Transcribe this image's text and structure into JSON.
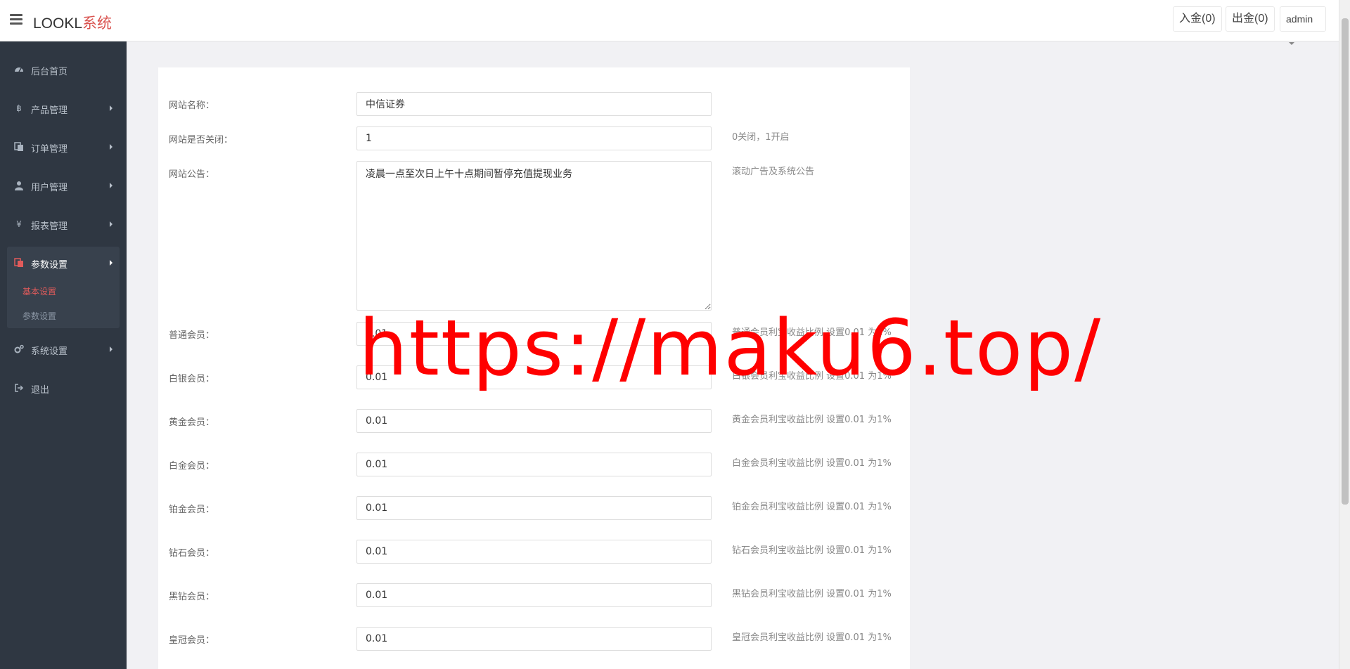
{
  "header": {
    "logo_main": "LOOKL",
    "logo_accent": "系统",
    "deposit_label": "入金(0)",
    "withdraw_label": "出金(0)",
    "user_label": "admin"
  },
  "sidebar": {
    "items": [
      {
        "label": "后台首页",
        "icon": "dashboard-icon"
      },
      {
        "label": "产品管理",
        "icon": "bitcoin-icon"
      },
      {
        "label": "订单管理",
        "icon": "copy-icon"
      },
      {
        "label": "用户管理",
        "icon": "user-icon"
      },
      {
        "label": "报表管理",
        "icon": "yen-icon"
      },
      {
        "label": "参数设置",
        "icon": "copy-icon"
      },
      {
        "label": "系统设置",
        "icon": "gears-icon"
      },
      {
        "label": "退出",
        "icon": "sign-out-icon"
      }
    ],
    "sub_items": [
      {
        "label": "基本设置"
      },
      {
        "label": "参数设置"
      }
    ]
  },
  "form": {
    "site_name": {
      "label": "网站名称：",
      "value": "中信证券"
    },
    "site_closed": {
      "label": "网站是否关闭：",
      "value": "1",
      "hint": "0关闭，1开启"
    },
    "notice": {
      "label": "网站公告：",
      "value": "凌晨一点至次日上午十点期间暂停充值提现业务",
      "hint": "滚动广告及系统公告"
    },
    "levels": [
      {
        "label": "普通会员：",
        "value": "0.01",
        "hint": "普通会员利宝收益比例 设置0.01 为1%"
      },
      {
        "label": "白银会员：",
        "value": "0.01",
        "hint": "白银会员利宝收益比例 设置0.01 为1%"
      },
      {
        "label": "黄金会员：",
        "value": "0.01",
        "hint": "黄金会员利宝收益比例 设置0.01 为1%"
      },
      {
        "label": "白金会员：",
        "value": "0.01",
        "hint": "白金会员利宝收益比例 设置0.01 为1%"
      },
      {
        "label": "铂金会员：",
        "value": "0.01",
        "hint": "铂金会员利宝收益比例 设置0.01 为1%"
      },
      {
        "label": "钻石会员：",
        "value": "0.01",
        "hint": "钻石会员利宝收益比例 设置0.01 为1%"
      },
      {
        "label": "黑钻会员：",
        "value": "0.01",
        "hint": "黑钻会员利宝收益比例 设置0.01 为1%"
      },
      {
        "label": "皇冠会员：",
        "value": "0.01",
        "hint": "皇冠会员利宝收益比例 设置0.01 为1%"
      }
    ]
  },
  "watermark": "https://maku6.top/"
}
